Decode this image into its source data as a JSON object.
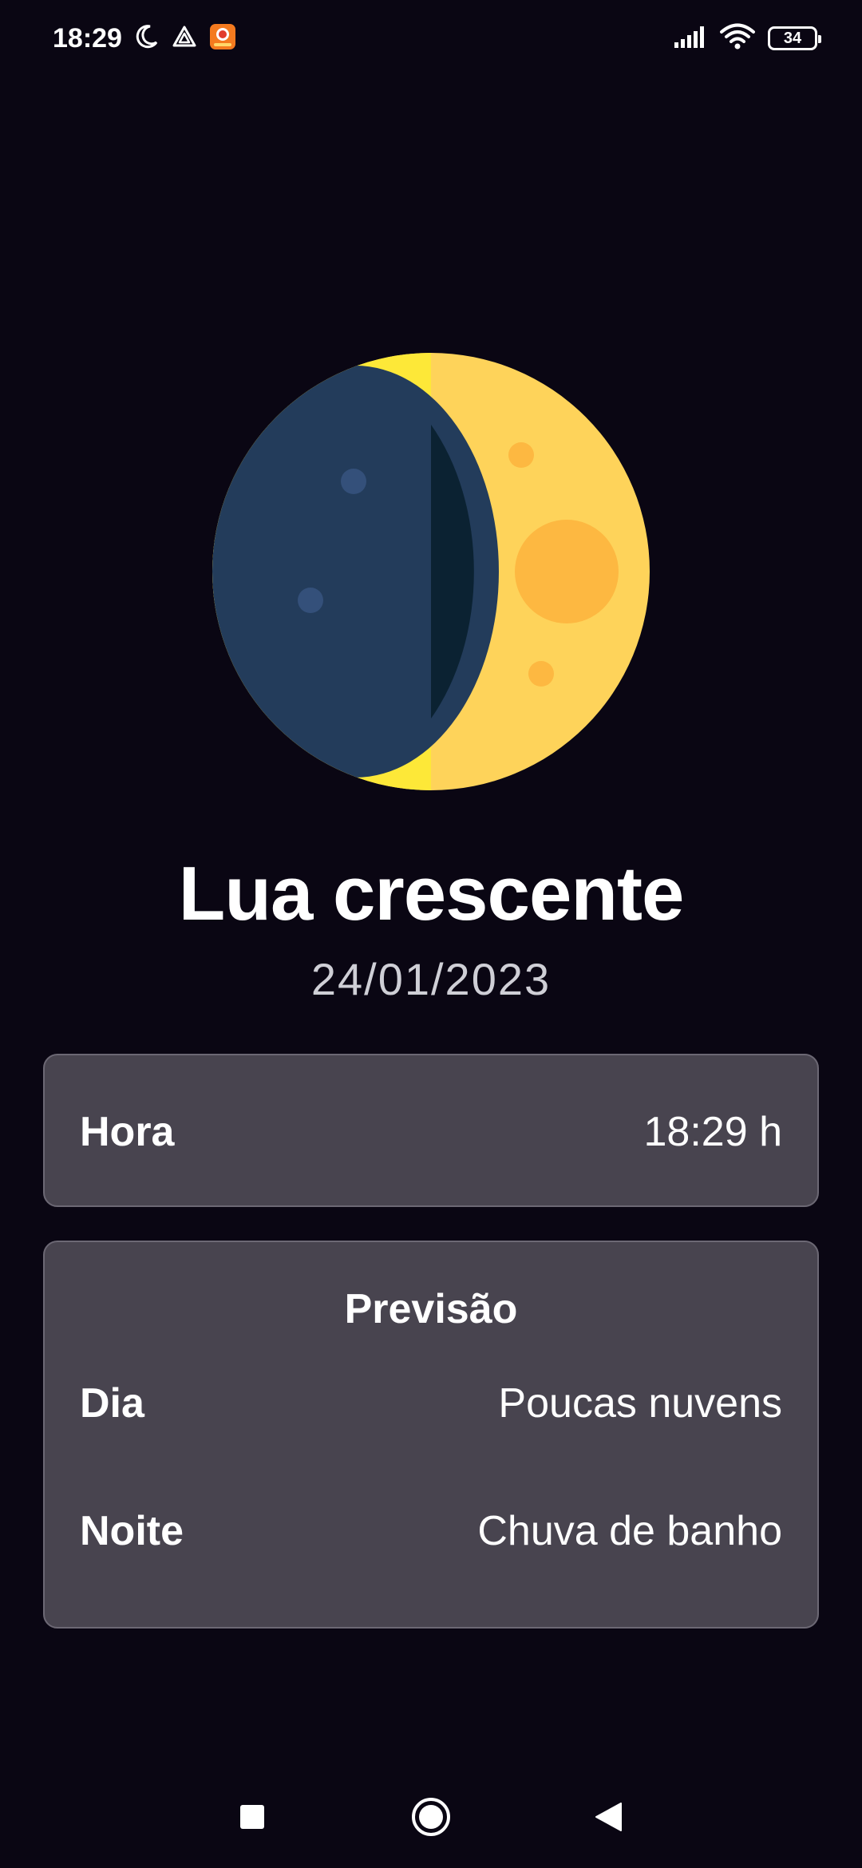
{
  "status_bar": {
    "time": "18:29",
    "battery_level": "34",
    "icons": [
      "moon-icon",
      "triangle-alert-icon",
      "app-notification-icon",
      "signal-icon",
      "wifi-icon",
      "battery-icon"
    ]
  },
  "moon": {
    "icon": "waxing-crescent-moon-icon",
    "colors": {
      "dark_face": "#233c5b",
      "dark_shadow": "#0b2232",
      "lit_face": "#fed35a",
      "lit_edge": "#fde838",
      "crater_lit": "#fdb841",
      "crater_dark": "#34507a"
    }
  },
  "phase": {
    "name": "Lua crescente",
    "date": "24/01/2023"
  },
  "time_card": {
    "label": "Hora",
    "value": "18:29 h"
  },
  "forecast_card": {
    "title": "Previsão",
    "rows": [
      {
        "label": "Dia",
        "value": "Poucas nuvens"
      },
      {
        "label": "Noite",
        "value": "Chuva de banho"
      }
    ]
  },
  "nav_bar": {
    "buttons": [
      "recents-button",
      "home-button",
      "back-button"
    ]
  }
}
